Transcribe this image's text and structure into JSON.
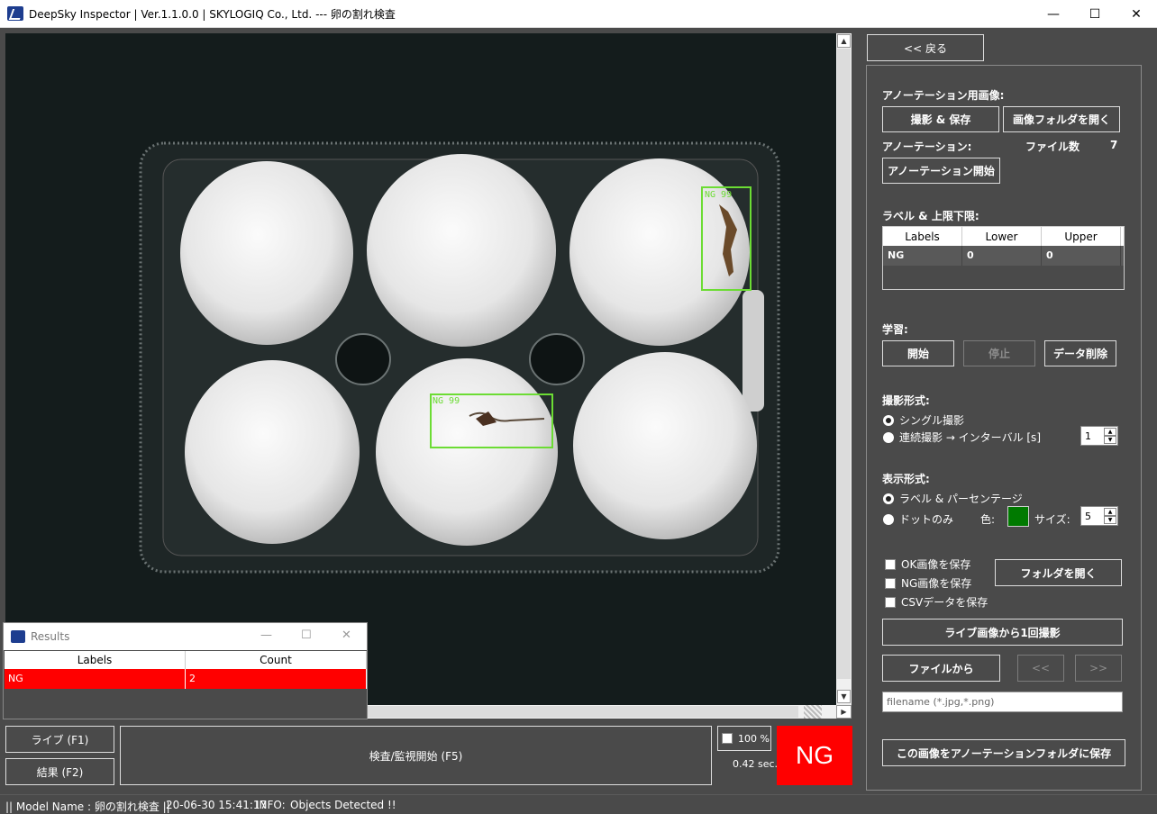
{
  "window": {
    "title": "DeepSky Inspector | Ver.1.1.0.0 | SKYLOGIQ Co., Ltd. --- 卵の割れ検査",
    "minimize": "—",
    "maximize": "☐",
    "close": "✕"
  },
  "viewer": {
    "detections": [
      {
        "label": "NG 99"
      },
      {
        "label": "NG 99"
      }
    ]
  },
  "results_window": {
    "title": "Results",
    "columns": [
      "Labels",
      "Count"
    ],
    "rows": [
      {
        "label": "NG",
        "count": "2"
      }
    ]
  },
  "bottom": {
    "live_button": "ライブ (F1)",
    "result_button": "結果 (F2)",
    "inspect_button": "検査/監視開始 (F5)",
    "zoom_label": "100 %",
    "elapsed": "0.42 sec.",
    "verdict": "NG",
    "verdict_color": "#ff0000"
  },
  "panel": {
    "back_button": "<< 戻る",
    "annotation_images_label": "アノーテーション用画像:",
    "capture_save_button": "撮影 & 保存",
    "open_image_folder_button": "画像フォルダを開く",
    "annotation_label": "アノーテーション:",
    "file_count_label": "ファイル数",
    "file_count": "7",
    "annotation_start_button": "アノーテーション開始",
    "label_limits_label": "ラベル & 上限下限:",
    "label_table": {
      "columns": [
        "Labels",
        "Lower",
        "Upper"
      ],
      "rows": [
        {
          "label": "NG",
          "lower": "0",
          "upper": "0"
        }
      ]
    },
    "learning_label": "学習:",
    "start_button": "開始",
    "stop_button": "停止",
    "delete_data_button": "データ削除",
    "capture_mode_label": "撮影形式:",
    "single_capture": "シングル撮影",
    "continuous_capture": "連続撮影 → インターバル [s]",
    "interval_value": "1",
    "display_mode_label": "表示形式:",
    "label_percentage": "ラベル & パーセンテージ",
    "dot_only": "ドットのみ",
    "color_label": "色:",
    "dot_color": "#007a00",
    "size_label": "サイズ:",
    "size_value": "5",
    "save_ok": "OK画像を保存",
    "save_ng": "NG画像を保存",
    "save_csv": "CSVデータを保存",
    "open_folder_button": "フォルダを開く",
    "capture_once_button": "ライブ画像から1回撮影",
    "from_file_button": "ファイルから",
    "prev_button": "<<",
    "next_button": ">>",
    "filename_placeholder": "filename (*.jpg,*.png)",
    "save_to_annotation_button": "この画像をアノーテーションフォルダに保存"
  },
  "status": {
    "model": "|| Model Name : 卵の割れ検査 ||",
    "timestamp": "20-06-30 15:41:17",
    "info_label": "INFO:",
    "info_text": "Objects Detected !!"
  }
}
